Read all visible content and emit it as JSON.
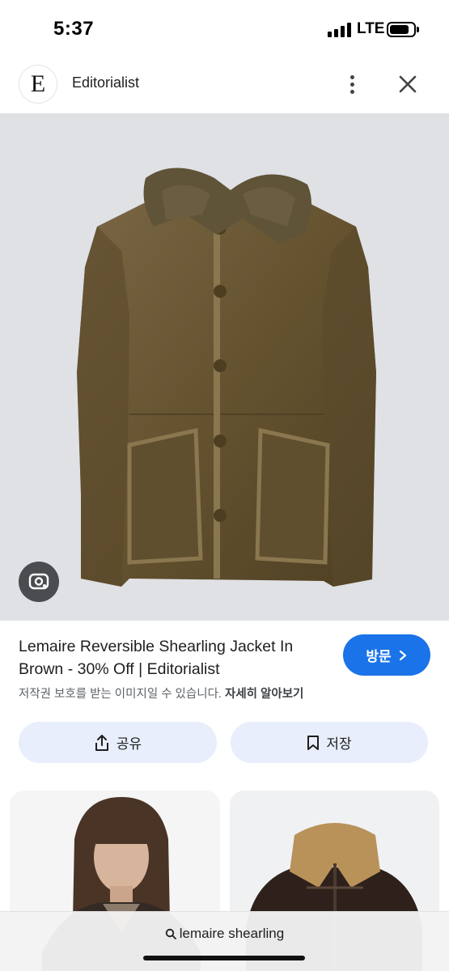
{
  "status_bar": {
    "time": "5:37",
    "network": "LTE"
  },
  "header": {
    "site_logo_letter": "E",
    "site_name": "Editorialist"
  },
  "product": {
    "title": "Lemaire Reversible Shearling Jacket In Brown - 30% Off | Editorialist",
    "visit_label": "방문",
    "copyright_text": "저작권 보호를 받는 이미지일 수 있습니다.",
    "learn_more_label": "자세히 알아보기"
  },
  "actions": {
    "share_label": "공유",
    "save_label": "저장"
  },
  "search": {
    "query": "lemaire shearling"
  },
  "colors": {
    "accent": "#1a73e8",
    "action_bg": "#e8eefb",
    "image_bg": "#dfe1e5",
    "jacket": "#6b5a3a",
    "collar": "#5c5038"
  }
}
